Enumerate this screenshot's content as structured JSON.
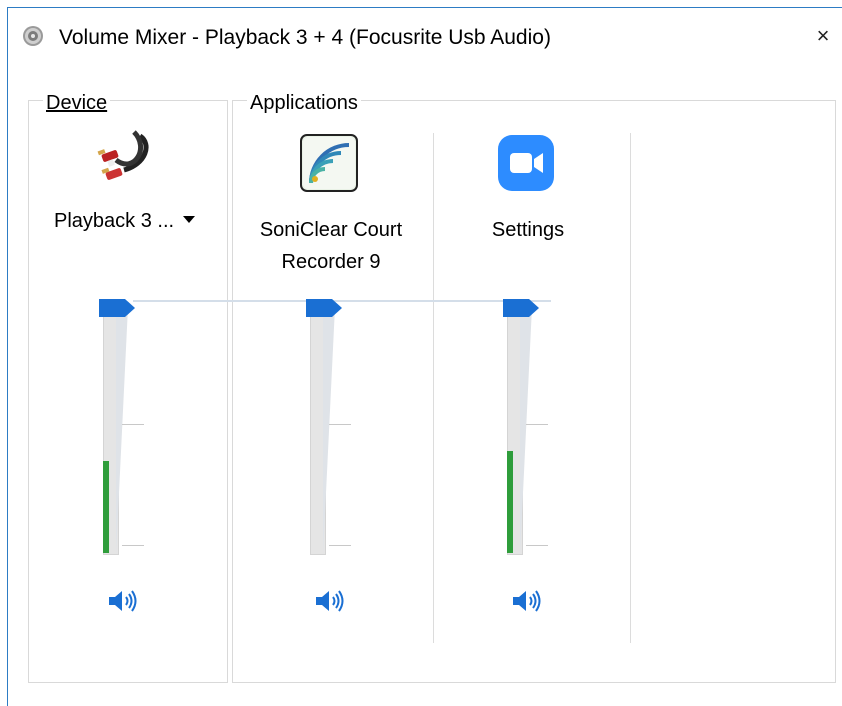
{
  "window": {
    "title": "Volume Mixer - Playback 3 + 4 (Focusrite Usb Audio)",
    "close_glyph": "×",
    "icon": "speaker-app-icon"
  },
  "device": {
    "group_label": "Device",
    "name": "Playback 3 ...",
    "icon": "rca-cable-icon",
    "volume_percent": 100,
    "peak_level_percent": 37
  },
  "applications": {
    "group_label": "Applications",
    "items": [
      {
        "name": "SoniClear Court Recorder 9",
        "line1": "SoniClear Court",
        "line2": "Recorder 9",
        "icon": "soniclear-icon",
        "volume_percent": 100,
        "peak_level_percent": 0
      },
      {
        "name": "Settings",
        "line1": "Settings",
        "line2": "",
        "icon": "zoom-camera-icon",
        "volume_percent": 100,
        "peak_level_percent": 41
      }
    ]
  },
  "colors": {
    "accent": "#1a6fd3",
    "meter": "#2f9d3b",
    "zoom_blue": "#2d8cff",
    "border": "#2d7cc4"
  }
}
